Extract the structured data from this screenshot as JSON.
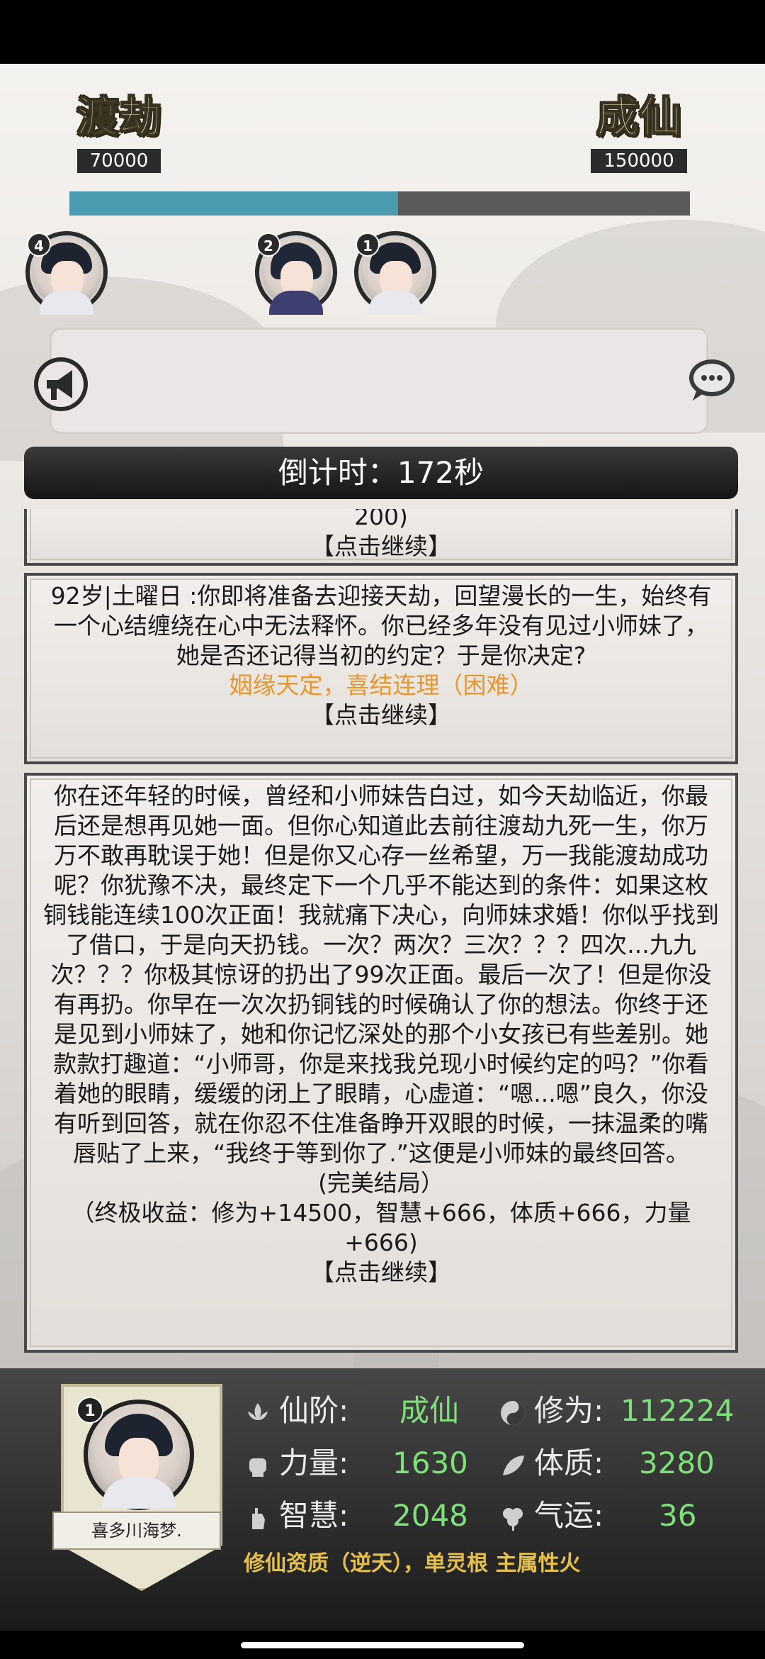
{
  "top": {
    "left_stage": {
      "name": "渡劫",
      "value": "70000"
    },
    "right_stage": {
      "name": "成仙",
      "value": "150000"
    },
    "progress_fraction": 0.53
  },
  "ranking": [
    {
      "rank": "4",
      "kind": "female"
    },
    {
      "rank": "2",
      "kind": "male"
    },
    {
      "rank": "1",
      "kind": "female"
    }
  ],
  "chat": {
    "message": ""
  },
  "countdown": "倒计时：172秒",
  "story": {
    "card1": {
      "line": "200)",
      "continue": "【点击继续】"
    },
    "card2": {
      "text": "92岁|土曜日 :你即将准备去迎接天劫，回望漫长的一生，始终有一个心结缠绕在心中无法释怀。你已经多年没有见过小师妹了，她是否还记得当初的约定？于是你决定?",
      "choice": "姻缘天定，喜结连理（困难）",
      "continue": "【点击继续】"
    },
    "card3": {
      "text": "你在还年轻的时候，曾经和小师妹告白过，如今天劫临近，你最后还是想再见她一面。但你心知道此去前往渡劫九死一生，你万万不敢再耽误于她！但是你又心存一丝希望，万一我能渡劫成功呢？你犹豫不决，最终定下一个几乎不能达到的条件：如果这枚铜钱能连续100次正面！我就痛下决心，向师妹求婚！你似乎找到了借口，于是向天扔钱。一次？两次？三次？？？四次...九九次？？？你极其惊讶的扔出了99次正面。最后一次了！但是你没有再扔。你早在一次次扔铜钱的时候确认了你的想法。你终于还是见到小师妹了，她和你记忆深处的那个小女孩已有些差别。她款款打趣道：“小师哥，你是来找我兑现小时候约定的吗？”你看着她的眼睛，缓缓的闭上了眼睛，心虚道：“嗯...嗯”良久，你没有听到回答，就在你忍不住准备睁开双眼的时候，一抹温柔的嘴唇贴了上来，“我终于等到你了.”这便是小师妹的最终回答。",
      "ending": "(完美结局）",
      "rewards": "（终极收益：修为+14500，智慧+666，体质+666，力量+666)",
      "continue": "【点击继续】"
    }
  },
  "player": {
    "rank": "1",
    "name": "喜多川海梦.",
    "stats": {
      "realm_label": "仙阶:",
      "realm_value": "成仙",
      "cultivation_label": "修为:",
      "cultivation_value": "112224",
      "strength_label": "力量:",
      "strength_value": "1630",
      "constitution_label": "体质:",
      "constitution_value": "3280",
      "wisdom_label": "智慧:",
      "wisdom_value": "2048",
      "luck_label": "气运:",
      "luck_value": "36"
    },
    "aptitude": "修仙资质（逆天），单灵根 主属性火"
  },
  "colors": {
    "progress": "#4a9bb0",
    "stat_value": "#7fe07a",
    "choice": "#e8962e",
    "aptitude": "#e7c04a"
  }
}
